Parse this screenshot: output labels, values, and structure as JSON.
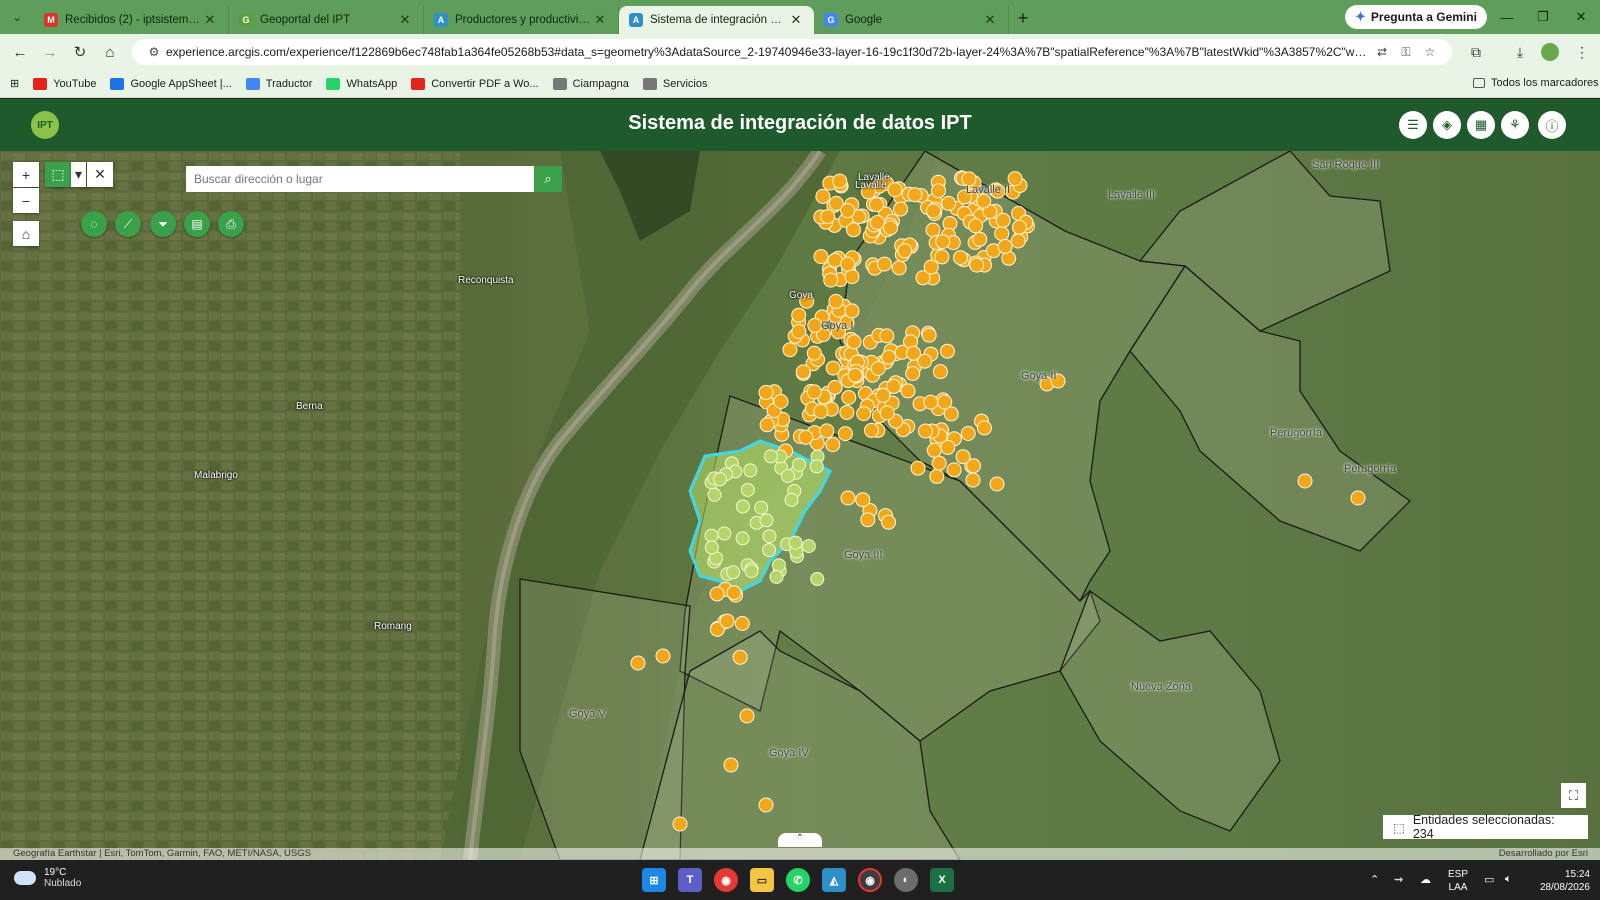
{
  "browser": {
    "tabs": [
      {
        "title": "Recibidos (2) - iptsistema@gm...",
        "favicon": "gmail-icon",
        "color": "#d9362b",
        "glyph": "M"
      },
      {
        "title": "Geoportal del IPT",
        "favicon": "ipt-icon",
        "color": "#5a9e3d",
        "glyph": "G"
      },
      {
        "title": "Productores y productividad",
        "favicon": "arcgis-icon",
        "color": "#2f8fc9",
        "glyph": "A"
      },
      {
        "title": "Sistema de integración de datos",
        "favicon": "arcgis-icon",
        "color": "#2f8fc9",
        "glyph": "A",
        "active": true
      },
      {
        "title": "Google",
        "favicon": "google-icon",
        "color": "#4285f4",
        "glyph": "G"
      }
    ],
    "gemini_label": "Pregunta a Gemini",
    "url": "experience.arcgis.com/experience/f122869b6ec748fab1a364fe05268b53#data_s=geometry%3AdataSource_2-19740946e33-layer-16-19c1f30d72b-layer-24%3A%7B\"spatialReference\"%3A%7B\"latestWkid\"%3A3857%2C\"wkid\"%3A102...",
    "bookmarks": [
      {
        "label": "YouTube",
        "color": "#e62117"
      },
      {
        "label": "Google AppSheet |...",
        "color": "#1a73e8"
      },
      {
        "label": "Traductor",
        "color": "#4285f4"
      },
      {
        "label": "WhatsApp",
        "color": "#25d366"
      },
      {
        "label": "Convertir PDF a Wo...",
        "color": "#e1251b"
      },
      {
        "label": "Ciampagna",
        "color": "#777"
      },
      {
        "label": "Servicios",
        "color": "#777"
      }
    ],
    "all_bookmarks": "Todos los marcadores"
  },
  "app": {
    "logo": "IPT",
    "title": "Sistema de integración de datos IPT",
    "search_placeholder": "Buscar dirección o lugar",
    "selected_count": "Entidades seleccionadas: 234",
    "attribution": "Geografía Earthstar | Esri, TomTom, Garmin, FAO, METI/NASA, USGS",
    "credit": "Desarrollado por Esri"
  },
  "map": {
    "places": [
      "Reconquista",
      "Berna",
      "Malabrigo",
      "Romang",
      "Goya",
      "Lavalle",
      "Lavalle"
    ],
    "zones": [
      "Lavalle II",
      "Lavalle III",
      "San Roque III",
      "Goya I",
      "Goya II",
      "Goya III",
      "Goya IV",
      "Goya V",
      "Perugorría",
      "Perugorría",
      "Nueva Zona"
    ],
    "colors": {
      "point": "#f2a71b",
      "selection": "#3fd9e6",
      "boundary": "#1b1b1b"
    }
  },
  "taskbar": {
    "temp": "19°C",
    "condition": "Nublado",
    "lang1": "ESP",
    "lang2": "LAA",
    "time": "15:24",
    "date": "28/08/2026"
  }
}
